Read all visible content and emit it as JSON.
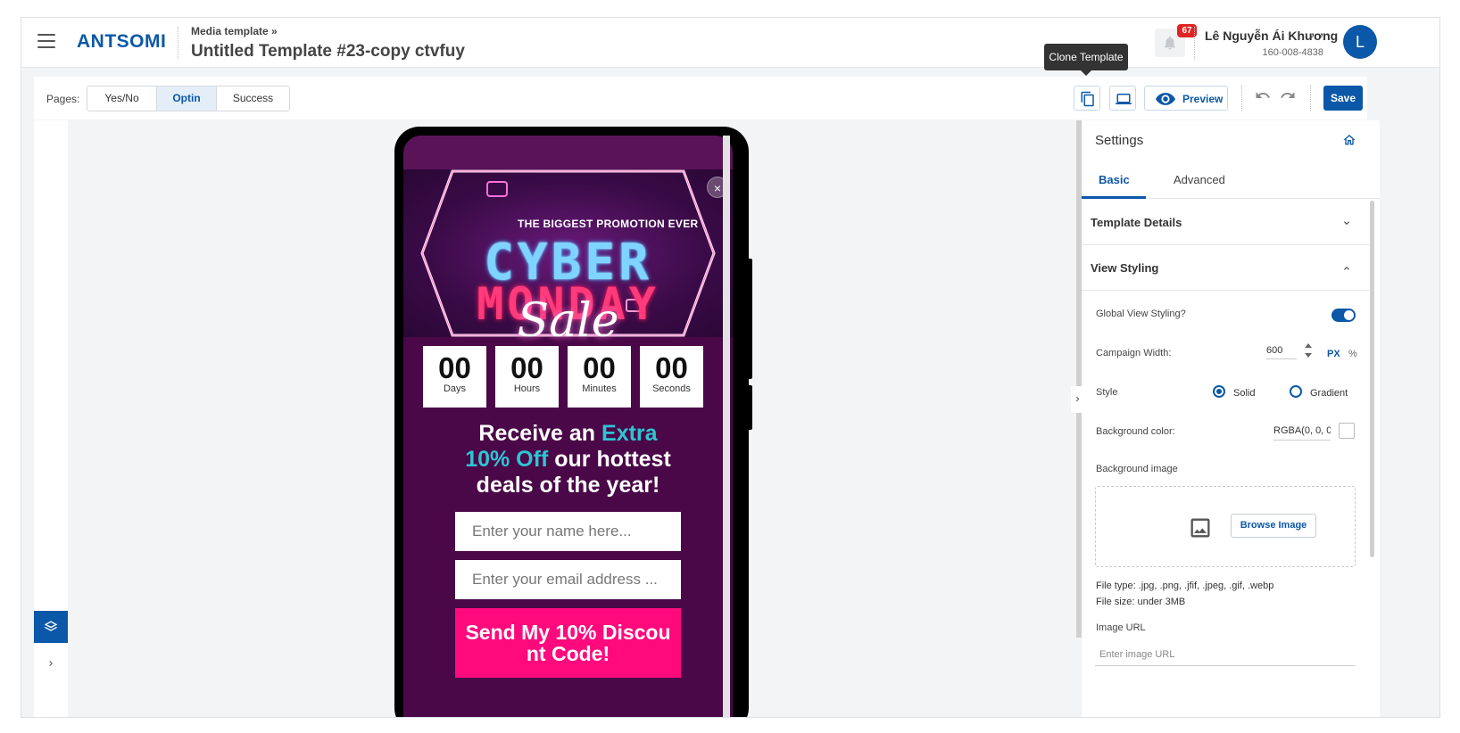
{
  "header": {
    "brand": "ANTSOMI",
    "breadcrumb": "Media template »",
    "title": "Untitled Template #23-copy ctvfuy",
    "notification_count": "67",
    "user_name": "Lê Nguyễn Ái Khương",
    "user_id": "160-008-4838",
    "avatar_initial": "L"
  },
  "toolbar": {
    "pages_label": "Pages:",
    "pages": [
      "Yes/No",
      "Optin",
      "Success"
    ],
    "active_page": "Optin",
    "clone_tooltip": "Clone Template",
    "preview_label": "Preview",
    "save_label": "Save"
  },
  "preview": {
    "promo_line": "THE BIGGEST PROMOTION EVER",
    "banner_line1": "CYBER",
    "banner_line2": "MONDAY",
    "banner_script": "Sale",
    "close_symbol": "×",
    "countdown": [
      {
        "value": "00",
        "label": "Days"
      },
      {
        "value": "00",
        "label": "Hours"
      },
      {
        "value": "00",
        "label": "Minutes"
      },
      {
        "value": "00",
        "label": "Seconds"
      }
    ],
    "headline_part1": "Receive an ",
    "headline_accent1": "Extra",
    "headline_accent2": "10% Off",
    "headline_part2": " our hottest",
    "headline_part3": "deals of the year!",
    "name_placeholder": "Enter your name here...",
    "email_placeholder": "Enter your email address ...",
    "cta_label": "Send My 10% Discou nt Code!"
  },
  "settings": {
    "title": "Settings",
    "tabs": [
      "Basic",
      "Advanced"
    ],
    "sections": [
      "Template Details",
      "View Styling"
    ],
    "global_view_styling_label": "Global View Styling?",
    "global_view_styling": true,
    "campaign_width_label": "Campaign Width:",
    "campaign_width": "600",
    "unit_px": "PX",
    "unit_pct": "%",
    "style_label": "Style",
    "style_options": [
      "Solid",
      "Gradient"
    ],
    "style_selected": "Solid",
    "bg_color_label": "Background color:",
    "bg_color_value": "RGBA(0, 0, 0",
    "bg_image_label": "Background image",
    "browse_label": "Browse Image",
    "file_type": "File type: .jpg, .png, .jfif, .jpeg, .gif, .webp",
    "file_size": "File size: under 3MB",
    "image_url_label": "Image URL",
    "image_url_placeholder": "Enter image URL"
  },
  "colors": {
    "brand_blue": "#0b58a8",
    "popup_bg": "#4a0848",
    "accent_cyan": "#2ec5d3",
    "cta_pink": "#ff0a7d",
    "badge_red": "#e02424"
  }
}
